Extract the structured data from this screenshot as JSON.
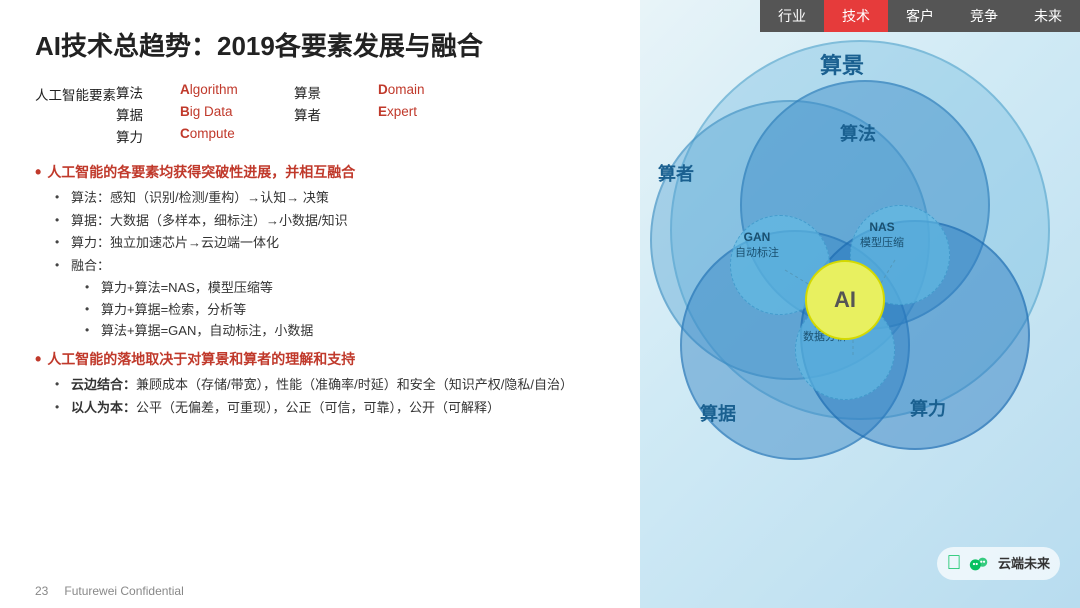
{
  "nav": {
    "items": [
      {
        "label": "行业",
        "active": false
      },
      {
        "label": "技术",
        "active": true
      },
      {
        "label": "客户",
        "active": false
      },
      {
        "label": "竞争",
        "active": false
      },
      {
        "label": "未来",
        "active": false
      }
    ]
  },
  "slide": {
    "title": "AI技术总趋势：2019各要素发展与融合",
    "elements_label": "人工智能要素",
    "elements": [
      {
        "zh": "算法",
        "en_bold": "A",
        "en_rest": "lgorithm",
        "zh2": "算景",
        "en2_bold": "D",
        "en2_rest": "omain"
      },
      {
        "zh": "算据",
        "en_bold": "B",
        "en_rest": "ig Data",
        "zh2": "算者",
        "en2_bold": "E",
        "en2_rest": "xpert"
      },
      {
        "zh": "算力",
        "en_bold": "C",
        "en_rest": "ompute",
        "zh2": "",
        "en2_bold": "",
        "en2_rest": ""
      }
    ],
    "red_bullets": [
      {
        "text": "人工智能的各要素均获得突破性进展，并相互融合",
        "sub_items": [
          "算法：感知（识别/检测/重构）→认知→ 决策",
          "算据：大数据（多样本，细标注）→小数据/知识",
          "算力：独立加速芯片→云边端一体化",
          "融合："
        ],
        "sub_sub_items": [
          "算力+算法=NAS，模型压缩等",
          "算力+算据=检索，分析等",
          "算法+算据=GAN，自动标注，小数据"
        ]
      },
      {
        "text": "人工智能的落地取决于对算景和算者的理解和支持",
        "sub_items": [
          "云边结合：兼顾成本（存储/带宽），性能（准确率/时延）和安全（知识产权/隐私/自治）",
          "以人为本：公平（无偏差，可重现），公正（可信，可靠），公开（可解释）"
        ],
        "sub_sub_items": []
      }
    ]
  },
  "diagram": {
    "labels": {
      "suanjing": "算景",
      "suanzhe": "算者",
      "suanfa": "算法",
      "suanju": "算据",
      "suanli": "算力",
      "ai": "AI",
      "gan": "GAN\n自动标注",
      "nas": "NAS\n模型压缩",
      "search": "搜索\n数据分析"
    }
  },
  "footer": {
    "page_number": "23",
    "confidential": "Futurewei Confidential"
  },
  "wechat": {
    "label": "云端未来"
  }
}
